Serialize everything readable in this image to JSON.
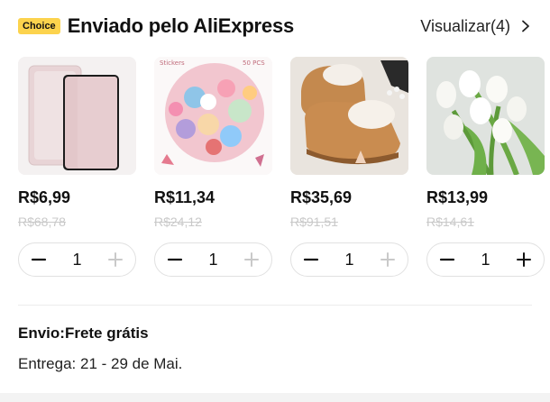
{
  "header": {
    "badge": "Choice",
    "title": "Enviado pelo AliExpress",
    "view_all": "Visualizar(4)"
  },
  "products": [
    {
      "name": "pink tablet case",
      "price": "R$6,99",
      "old_price": "R$68,78",
      "qty": "1",
      "icon": "tablet-case-image"
    },
    {
      "name": "stickers pack",
      "price": "R$11,34",
      "old_price": "R$24,12",
      "qty": "1",
      "icon": "stickers-image",
      "image_text": "Stickers",
      "image_count": "50 PCS"
    },
    {
      "name": "fur slippers",
      "price": "R$35,69",
      "old_price": "R$91,51",
      "qty": "1",
      "icon": "slippers-image"
    },
    {
      "name": "artificial tulips",
      "price": "R$13,99",
      "old_price": "R$14,61",
      "qty": "1",
      "icon": "tulips-image"
    }
  ],
  "shipping": {
    "label": "Envio:Frete grátis",
    "delivery": "Entrega: 21 - 29 de Mai."
  },
  "colors": {
    "badge_bg": "#fcd34d",
    "old_price": "#c9c9c9",
    "border": "#e1e1e1"
  }
}
